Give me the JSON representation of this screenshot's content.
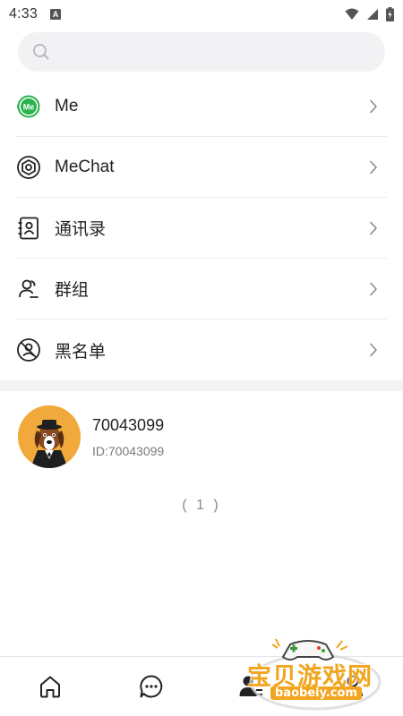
{
  "status_bar": {
    "time": "4:33",
    "notification_letter": "A"
  },
  "search": {
    "placeholder": "",
    "value": ""
  },
  "menu": {
    "items": [
      {
        "label": "Me",
        "icon": "me-badge-icon"
      },
      {
        "label": "MeChat",
        "icon": "mechat-icon"
      },
      {
        "label": "通讯录",
        "icon": "contacts-book-icon"
      },
      {
        "label": "群组",
        "icon": "group-icon"
      },
      {
        "label": "黑名单",
        "icon": "blacklist-icon"
      }
    ]
  },
  "contact": {
    "name": "70043099",
    "id_text": "ID:70043099"
  },
  "list_count": "( 1 )",
  "tabbar": {
    "tabs": [
      "home-icon",
      "chat-icon",
      "contacts-icon",
      "profile-icon"
    ]
  },
  "watermark": {
    "text": "宝贝游戏网",
    "sub": "baobeiy.com"
  },
  "colors": {
    "accent_green": "#2bb24c",
    "watermark_orange": "#f2a51e",
    "avatar_bg": "#f2a93b"
  }
}
